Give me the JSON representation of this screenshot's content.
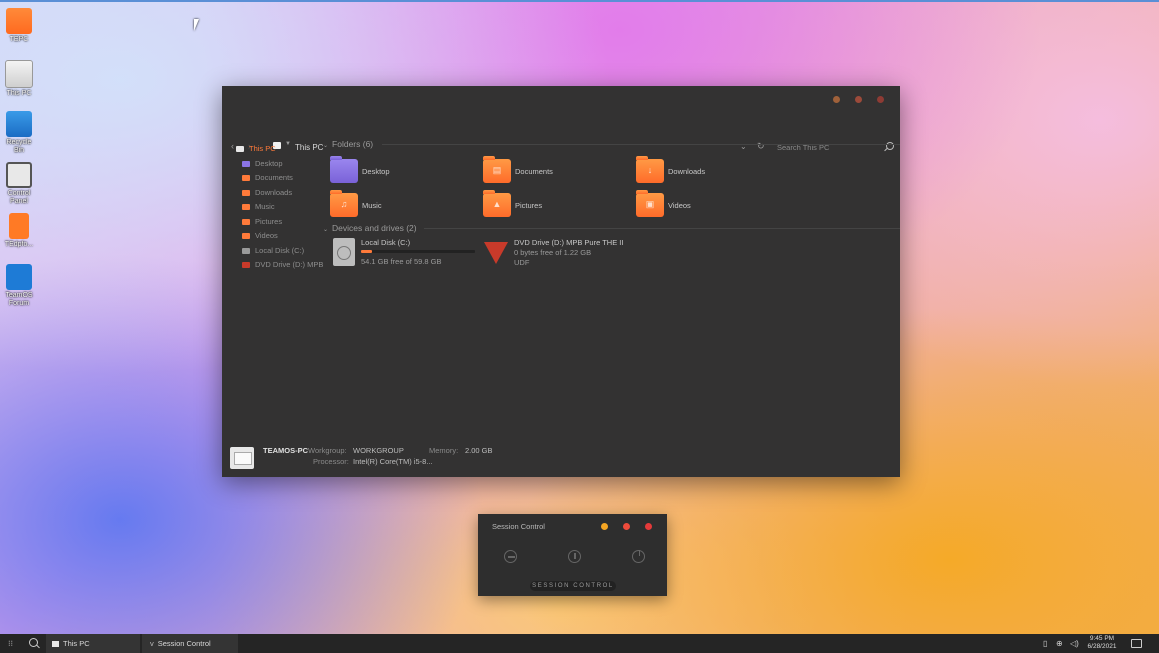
{
  "desktop": {
    "icons": [
      {
        "label": "TEPC",
        "icon": "folder-icon"
      },
      {
        "label": "This PC",
        "icon": "this-pc-icon"
      },
      {
        "label": "Recycle Bin",
        "icon": "recycle-bin-icon"
      },
      {
        "label": "Control Panel",
        "icon": "control-panel-icon"
      },
      {
        "label": "TEdpfo...",
        "icon": "app-icon"
      },
      {
        "label": "TeamOS Forum",
        "icon": "teamos-icon"
      }
    ]
  },
  "explorer": {
    "breadcrumb": "This PC",
    "search_placeholder": "Search This PC",
    "nav": [
      {
        "label": "This PC",
        "icon": "this-pc-icon"
      },
      {
        "label": "Desktop",
        "icon": "desktop-folder-icon"
      },
      {
        "label": "Documents",
        "icon": "documents-folder-icon"
      },
      {
        "label": "Downloads",
        "icon": "downloads-folder-icon"
      },
      {
        "label": "Music",
        "icon": "music-folder-icon"
      },
      {
        "label": "Pictures",
        "icon": "pictures-folder-icon"
      },
      {
        "label": "Videos",
        "icon": "videos-folder-icon"
      },
      {
        "label": "Local Disk (C:)",
        "icon": "disk-icon"
      },
      {
        "label": "DVD Drive (D:) MPB",
        "icon": "dvd-icon"
      }
    ],
    "folders_header": "Folders (6)",
    "folders": [
      {
        "name": "Desktop",
        "icon": "desktop-folder-icon"
      },
      {
        "name": "Documents",
        "icon": "documents-folder-icon"
      },
      {
        "name": "Downloads",
        "icon": "downloads-folder-icon"
      },
      {
        "name": "Music",
        "icon": "music-folder-icon"
      },
      {
        "name": "Pictures",
        "icon": "pictures-folder-icon"
      },
      {
        "name": "Videos",
        "icon": "videos-folder-icon"
      }
    ],
    "devices_header": "Devices and drives (2)",
    "drives": [
      {
        "name": "Local Disk (C:)",
        "space": "54.1 GB free of 59.8 GB",
        "used_fraction": 0.1
      },
      {
        "name": "DVD Drive (D:) MPB Pure THE II",
        "space": "0 bytes free of 1.22 GB",
        "fs": "UDF"
      }
    ],
    "details": {
      "pc_name": "TEAMOS-PC",
      "workgroup_label": "Workgroup:",
      "workgroup": "WORKGROUP",
      "memory_label": "Memory:",
      "memory": "2.00 GB",
      "processor_label": "Processor:",
      "processor": "Intel(R) Core(TM) i5-8..."
    }
  },
  "session": {
    "title": "Session Control",
    "label": "SESSION CONTROL",
    "buttons": [
      "logout-icon",
      "sleep-icon",
      "power-icon"
    ]
  },
  "taskbar": {
    "tasks": [
      {
        "label": "This PC"
      },
      {
        "label": "Session Control"
      }
    ],
    "time": "9:45 PM",
    "date": "6/28/2021"
  },
  "colors": {
    "accent": "#ff7a3a",
    "window_bg": "#333232",
    "dot_yellow": "#f5a623",
    "dot_red": "#ee4b3b"
  }
}
